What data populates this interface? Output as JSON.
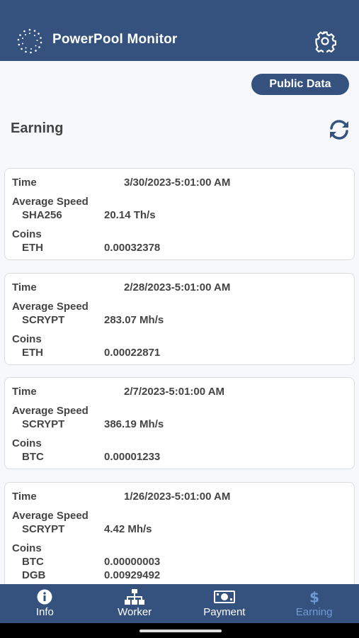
{
  "app": {
    "title": "PowerPool Monitor"
  },
  "actions": {
    "public_data": "Public Data"
  },
  "section": {
    "title": "Earning"
  },
  "labels": {
    "time": "Time",
    "average_speed": "Average Speed",
    "coins": "Coins"
  },
  "records": [
    {
      "time": "3/30/2023-5:01:00 AM",
      "algo": "SHA256",
      "speed": "20.14 Th/s",
      "coins": [
        {
          "name": "ETH",
          "amount": "0.00032378"
        }
      ]
    },
    {
      "time": "2/28/2023-5:01:00 AM",
      "algo": "SCRYPT",
      "speed": "283.07 Mh/s",
      "coins": [
        {
          "name": "ETH",
          "amount": "0.00022871"
        }
      ]
    },
    {
      "time": "2/7/2023-5:01:00 AM",
      "algo": "SCRYPT",
      "speed": "386.19 Mh/s",
      "coins": [
        {
          "name": "BTC",
          "amount": "0.00001233"
        }
      ]
    },
    {
      "time": "1/26/2023-5:01:00 AM",
      "algo": "SCRYPT",
      "speed": "4.42 Mh/s",
      "coins": [
        {
          "name": "BTC",
          "amount": "0.00000003"
        },
        {
          "name": "DGB",
          "amount": "0.00929492"
        }
      ]
    }
  ],
  "nav": [
    {
      "label": "Info",
      "icon": "info-icon"
    },
    {
      "label": "Worker",
      "icon": "sitemap-icon"
    },
    {
      "label": "Payment",
      "icon": "money-bill-icon"
    },
    {
      "label": "Earning",
      "icon": "dollar-icon",
      "active": true
    }
  ],
  "colors": {
    "primary": "#35527f",
    "active_tab": "#6f9ad6",
    "background": "#f6f8fc"
  }
}
